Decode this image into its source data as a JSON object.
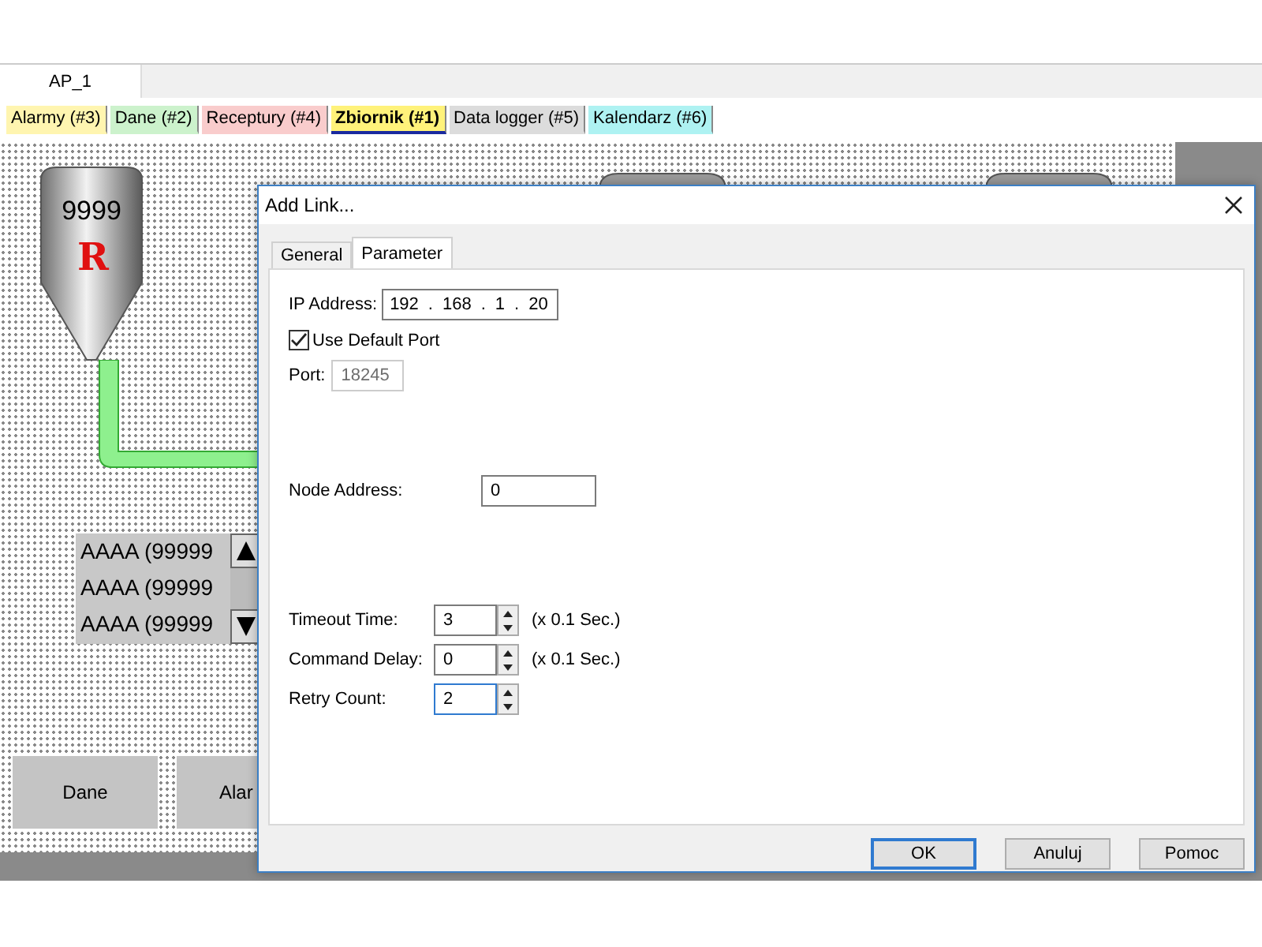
{
  "document_tabs": [
    {
      "label": "AP_1",
      "selected": true
    }
  ],
  "screen_tabs": [
    {
      "label": "Alarmy (#3)",
      "color": "#fff5b0",
      "selected": false
    },
    {
      "label": "Dane (#2)",
      "color": "#ccf2cc",
      "selected": false
    },
    {
      "label": "Receptury (#4)",
      "color": "#f9cccc",
      "selected": false
    },
    {
      "label": "Zbiornik (#1)",
      "color": "#fff27a",
      "selected": true
    },
    {
      "label": "Data logger (#5)",
      "color": "#dcdcdc",
      "selected": false
    },
    {
      "label": "Kalendarz (#6)",
      "color": "#aef2f2",
      "selected": false
    }
  ],
  "canvas": {
    "tank": {
      "value": "9999",
      "mark": "R"
    },
    "list_items": [
      "AAAA (99999",
      "AAAA (99999",
      "AAAA (99999"
    ],
    "buttons": [
      "Dane",
      "Alar"
    ]
  },
  "dialog": {
    "title": "Add Link...",
    "tabs": [
      {
        "label": "General",
        "selected": false
      },
      {
        "label": "Parameter",
        "selected": true
      }
    ],
    "ip_label": "IP Address:",
    "ip_octets": [
      "192",
      "168",
      "1",
      "20"
    ],
    "ip_separator": ".",
    "use_default_port": {
      "label": "Use Default Port",
      "checked": true
    },
    "port": {
      "label": "Port:",
      "value": "18245",
      "disabled": true
    },
    "node_address": {
      "label": "Node Address:",
      "value": "0"
    },
    "spinners": [
      {
        "label": "Timeout Time:",
        "value": "3",
        "unit": "(x 0.1 Sec.)",
        "focused": false
      },
      {
        "label": "Command Delay:",
        "value": "0",
        "unit": "(x 0.1 Sec.)",
        "focused": false
      },
      {
        "label": "Retry Count:",
        "value": "2",
        "focused": true
      }
    ],
    "buttons": [
      {
        "label": "OK",
        "default": true
      },
      {
        "label": "Anuluj",
        "default": false
      },
      {
        "label": "Pomoc",
        "default": false
      }
    ]
  }
}
